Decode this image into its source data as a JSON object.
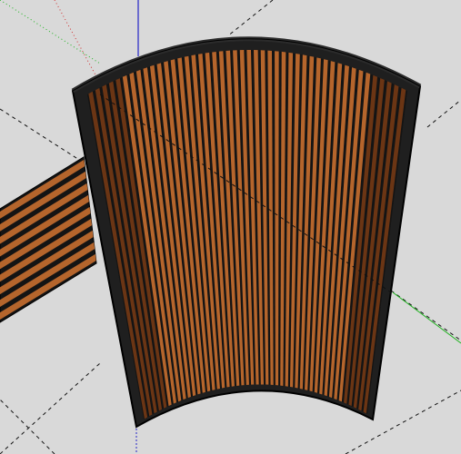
{
  "viewport": {
    "background_color": "#d9d9d9"
  },
  "colors": {
    "wood_light": "#b5652c",
    "wood_dark": "#6b3514",
    "gap": "#141414",
    "frame": "#1f1f1f",
    "edge": "#000000",
    "axis_red": "#d03030",
    "axis_green": "#1fb31f",
    "axis_blue": "#2323c8",
    "guide": "#111111"
  },
  "scene": {
    "model": "curved-slat-panel",
    "secondary_model": "flat-slat-panel",
    "panel_slat_count": 46,
    "flat_slat_count": 9
  }
}
